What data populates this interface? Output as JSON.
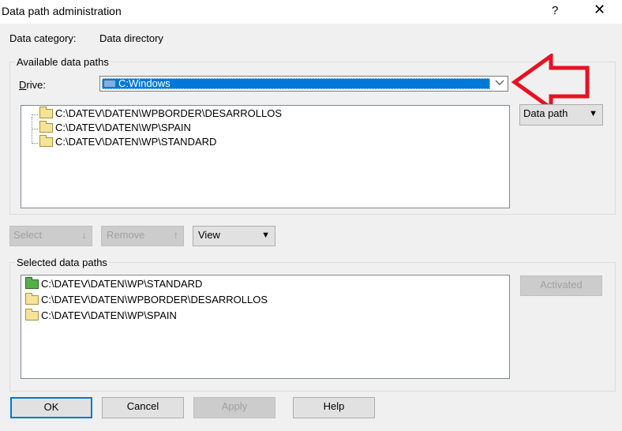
{
  "window": {
    "title": "Data path administration",
    "help_glyph": "?",
    "close_glyph": "✕"
  },
  "header": {
    "category_label": "Data category:",
    "category_value": "Data directory"
  },
  "available": {
    "group_title": "Available data paths",
    "drive_label": "Drive:",
    "drive_value": "C:Windows",
    "paths": [
      "C:\\DATEV\\DATEN\\WPBORDER\\DESARROLLOS",
      "C:\\DATEV\\DATEN\\WP\\SPAIN",
      "C:\\DATEV\\DATEN\\WP\\STANDARD"
    ],
    "data_path_button": "Data path"
  },
  "actions": {
    "select_label": "Select",
    "remove_label": "Remove",
    "view_label": "View"
  },
  "selected": {
    "group_title": "Selected data paths",
    "paths": [
      "C:\\DATEV\\DATEN\\WP\\STANDARD",
      "C:\\DATEV\\DATEN\\WPBORDER\\DESARROLLOS",
      "C:\\DATEV\\DATEN\\WP\\SPAIN"
    ],
    "activated_label": "Activated"
  },
  "footer": {
    "ok": "OK",
    "cancel": "Cancel",
    "apply": "Apply",
    "help": "Help"
  },
  "colors": {
    "selection": "#0078d7",
    "annotation_arrow": "#e81123",
    "active_folder": "#57b045"
  }
}
